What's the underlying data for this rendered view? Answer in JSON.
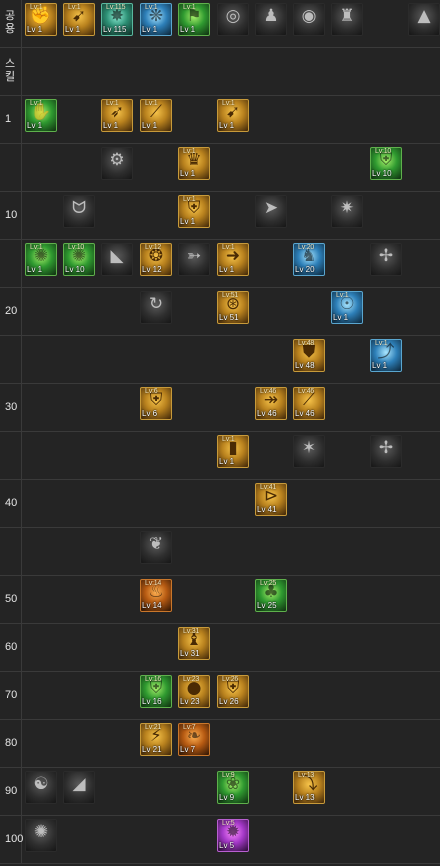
{
  "rows": [
    {
      "label": "공용",
      "icons": [
        {
          "col": 0,
          "glyph": "fist-icon",
          "color": "gold",
          "cap": "Lv:1",
          "lv": "Lv 1"
        },
        {
          "col": 1,
          "glyph": "kick-icon",
          "color": "gold",
          "cap": "Lv:1",
          "lv": "Lv 1"
        },
        {
          "col": 2,
          "glyph": "punch-icon",
          "color": "teal",
          "cap": "Lv:115",
          "lv": "Lv 115"
        },
        {
          "col": 3,
          "glyph": "wing-icon",
          "color": "blue",
          "cap": "Lv:1",
          "lv": "Lv 1"
        },
        {
          "col": 4,
          "glyph": "runner-icon",
          "color": "green",
          "cap": "Lv:1",
          "lv": "Lv 1"
        },
        {
          "col": 5,
          "glyph": "target-icon",
          "color": "gray"
        },
        {
          "col": 6,
          "glyph": "silhouette-icon",
          "color": "gray"
        },
        {
          "col": 7,
          "glyph": "eye-icon",
          "color": "gray"
        },
        {
          "col": 8,
          "glyph": "armor-icon",
          "color": "gray"
        },
        {
          "col": 10,
          "glyph": "mountain-icon",
          "color": "gray"
        }
      ]
    },
    {
      "label": "스킬",
      "icons": []
    },
    {
      "label": "1",
      "icons": [
        {
          "col": 0,
          "glyph": "hand-icon",
          "color": "green",
          "cap": "Lv:1",
          "lv": "Lv 1"
        },
        {
          "col": 2,
          "glyph": "uppercut-icon",
          "color": "gold",
          "cap": "Lv:1",
          "lv": "Lv 1"
        },
        {
          "col": 3,
          "glyph": "slash-icon",
          "color": "gold",
          "cap": "Lv:1",
          "lv": "Lv 1"
        },
        {
          "col": 5,
          "glyph": "kick-icon",
          "color": "gold",
          "cap": "Lv:1",
          "lv": "Lv 1"
        }
      ]
    },
    {
      "label": "",
      "icons": [
        {
          "col": 2,
          "glyph": "gear-icon",
          "color": "gray"
        },
        {
          "col": 4,
          "glyph": "cup-icon",
          "color": "gold",
          "cap": "Lv:1",
          "lv": "Lv 1"
        },
        {
          "col": 9,
          "glyph": "shield-icon",
          "color": "green",
          "cap": "Lv:10",
          "lv": "Lv 10"
        }
      ]
    },
    {
      "label": "10",
      "icons": [
        {
          "col": 1,
          "glyph": "claw-icon",
          "color": "gray"
        },
        {
          "col": 4,
          "glyph": "shield-icon",
          "color": "gold",
          "cap": "Lv:1",
          "lv": "Lv 1"
        },
        {
          "col": 6,
          "glyph": "arrows-icon",
          "color": "gray"
        },
        {
          "col": 8,
          "glyph": "crash-icon",
          "color": "gray"
        }
      ]
    },
    {
      "label": "",
      "icons": [
        {
          "col": 0,
          "glyph": "burst-icon",
          "color": "green",
          "cap": "Lv:1",
          "lv": "Lv 1"
        },
        {
          "col": 1,
          "glyph": "burst-icon",
          "color": "green",
          "cap": "Lv:10",
          "lv": "Lv 10"
        },
        {
          "col": 2,
          "glyph": "boot-icon",
          "color": "gray"
        },
        {
          "col": 3,
          "glyph": "swirl-icon",
          "color": "gold",
          "cap": "Lv:12",
          "lv": "Lv 12"
        },
        {
          "col": 4,
          "glyph": "sprint-icon",
          "color": "gray"
        },
        {
          "col": 5,
          "glyph": "dash-icon",
          "color": "gold",
          "cap": "Lv:1",
          "lv": "Lv 1"
        },
        {
          "col": 7,
          "glyph": "figure-icon",
          "color": "blue",
          "cap": "Lv:20",
          "lv": "Lv 20"
        },
        {
          "col": 9,
          "glyph": "tangle-icon",
          "color": "gray"
        }
      ]
    },
    {
      "label": "20",
      "icons": [
        {
          "col": 3,
          "glyph": "spin-kick-icon",
          "color": "gray"
        },
        {
          "col": 5,
          "glyph": "vortex-icon",
          "color": "gold",
          "cap": "Lv:51",
          "lv": "Lv 51"
        },
        {
          "col": 8,
          "glyph": "aura-icon",
          "color": "blue",
          "cap": "Lv:1",
          "lv": "Lv 1"
        }
      ]
    },
    {
      "label": "",
      "icons": [
        {
          "col": 7,
          "glyph": "shield-strike-icon",
          "color": "gold",
          "cap": "Lv:48",
          "lv": "Lv 48"
        },
        {
          "col": 9,
          "glyph": "leap-icon",
          "color": "blue",
          "cap": "Lv:1",
          "lv": "Lv 1"
        }
      ]
    },
    {
      "label": "30",
      "icons": [
        {
          "col": 3,
          "glyph": "shield-icon",
          "color": "gold",
          "cap": "Lv:6",
          "lv": "Lv 6"
        },
        {
          "col": 6,
          "glyph": "lance-icon",
          "color": "gold",
          "cap": "Lv:46",
          "lv": "Lv 46"
        },
        {
          "col": 7,
          "glyph": "slash-icon",
          "color": "gold",
          "cap": "Lv:46",
          "lv": "Lv 46"
        }
      ]
    },
    {
      "label": "",
      "icons": [
        {
          "col": 5,
          "glyph": "bar-icon",
          "color": "gold",
          "cap": "Lv:1",
          "lv": "Lv 1"
        },
        {
          "col": 7,
          "glyph": "shatter-icon",
          "color": "gray"
        },
        {
          "col": 9,
          "glyph": "tangle-icon",
          "color": "gray"
        }
      ]
    },
    {
      "label": "40",
      "icons": [
        {
          "col": 6,
          "glyph": "drill-icon",
          "color": "gold",
          "cap": "Lv:41",
          "lv": "Lv 41"
        }
      ]
    },
    {
      "label": "",
      "icons": [
        {
          "col": 3,
          "glyph": "flap-icon",
          "color": "gray"
        }
      ]
    },
    {
      "label": "50",
      "icons": [
        {
          "col": 3,
          "glyph": "flame-kick-icon",
          "color": "orange",
          "cap": "Lv:14",
          "lv": "Lv 14"
        },
        {
          "col": 6,
          "glyph": "tree-icon",
          "color": "green",
          "cap": "Lv:25",
          "lv": "Lv 25"
        }
      ]
    },
    {
      "label": "60",
      "icons": [
        {
          "col": 4,
          "glyph": "stance-icon",
          "color": "gold",
          "cap": "Lv:31",
          "lv": "Lv 31"
        }
      ]
    },
    {
      "label": "70",
      "icons": [
        {
          "col": 3,
          "glyph": "shield-icon",
          "color": "green",
          "cap": "Lv:16",
          "lv": "Lv 16"
        },
        {
          "col": 4,
          "glyph": "orb-icon",
          "color": "gold",
          "cap": "Lv:23",
          "lv": "Lv 23"
        },
        {
          "col": 5,
          "glyph": "shield-icon",
          "color": "gold",
          "cap": "Lv:26",
          "lv": "Lv 26"
        }
      ]
    },
    {
      "label": "80",
      "icons": [
        {
          "col": 3,
          "glyph": "strike-icon",
          "color": "gold",
          "cap": "Lv:21",
          "lv": "Lv 21"
        },
        {
          "col": 4,
          "glyph": "phoenix-icon",
          "color": "orange",
          "cap": "Lv:7",
          "lv": "Lv 7"
        }
      ]
    },
    {
      "label": "90",
      "icons": [
        {
          "col": 0,
          "glyph": "meditate-icon",
          "color": "gray"
        },
        {
          "col": 1,
          "glyph": "stomp-icon",
          "color": "gray"
        },
        {
          "col": 5,
          "glyph": "spirit-icon",
          "color": "green",
          "cap": "Lv:9",
          "lv": "Lv 9"
        },
        {
          "col": 7,
          "glyph": "dive-icon",
          "color": "gold",
          "cap": "Lv:13",
          "lv": "Lv 13"
        }
      ]
    },
    {
      "label": "100",
      "icons": [
        {
          "col": 0,
          "glyph": "burst-icon",
          "color": "gray"
        },
        {
          "col": 5,
          "glyph": "nova-icon",
          "color": "purple",
          "cap": "Lv:5",
          "lv": "Lv 5"
        }
      ]
    }
  ]
}
